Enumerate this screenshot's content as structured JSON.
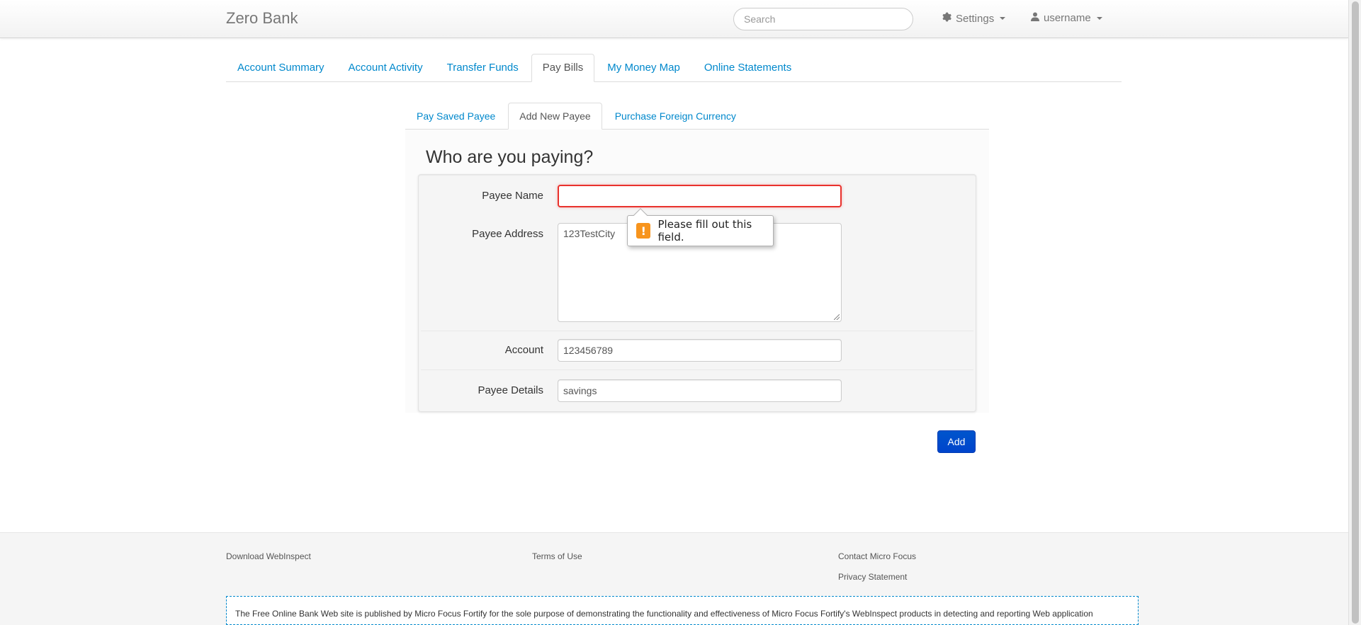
{
  "navbar": {
    "brand": "Zero Bank",
    "search_placeholder": "Search",
    "settings_label": "Settings",
    "user_label": "username"
  },
  "main_tabs": [
    {
      "label": "Account Summary",
      "active": false
    },
    {
      "label": "Account Activity",
      "active": false
    },
    {
      "label": "Transfer Funds",
      "active": false
    },
    {
      "label": "Pay Bills",
      "active": true
    },
    {
      "label": "My Money Map",
      "active": false
    },
    {
      "label": "Online Statements",
      "active": false
    }
  ],
  "sub_tabs": [
    {
      "label": "Pay Saved Payee",
      "active": false
    },
    {
      "label": "Add New Payee",
      "active": true
    },
    {
      "label": "Purchase Foreign Currency",
      "active": false
    }
  ],
  "form": {
    "heading": "Who are you paying?",
    "payee_name_label": "Payee Name",
    "payee_name_value": "",
    "payee_address_label": "Payee Address",
    "payee_address_value": "123TestCity",
    "account_label": "Account",
    "account_value": "123456789",
    "payee_details_label": "Payee Details",
    "payee_details_value": "savings",
    "add_button": "Add"
  },
  "validation": {
    "message": "Please fill out this field.",
    "icon": "warning-icon",
    "icon_glyph": "!"
  },
  "footer": {
    "download": "Download WebInspect",
    "terms": "Terms of Use",
    "contact": "Contact Micro Focus",
    "privacy": "Privacy Statement",
    "disclaimer": "The Free Online Bank Web site is published by Micro Focus Fortify for the sole purpose of demonstrating the functionality and effectiveness of Micro Focus Fortify's WebInspect products in detecting and reporting Web application"
  },
  "colors": {
    "link": "#0088cc",
    "primary_button": "#0044cc",
    "invalid_border": "#e9322d",
    "warning": "#f7941d"
  }
}
